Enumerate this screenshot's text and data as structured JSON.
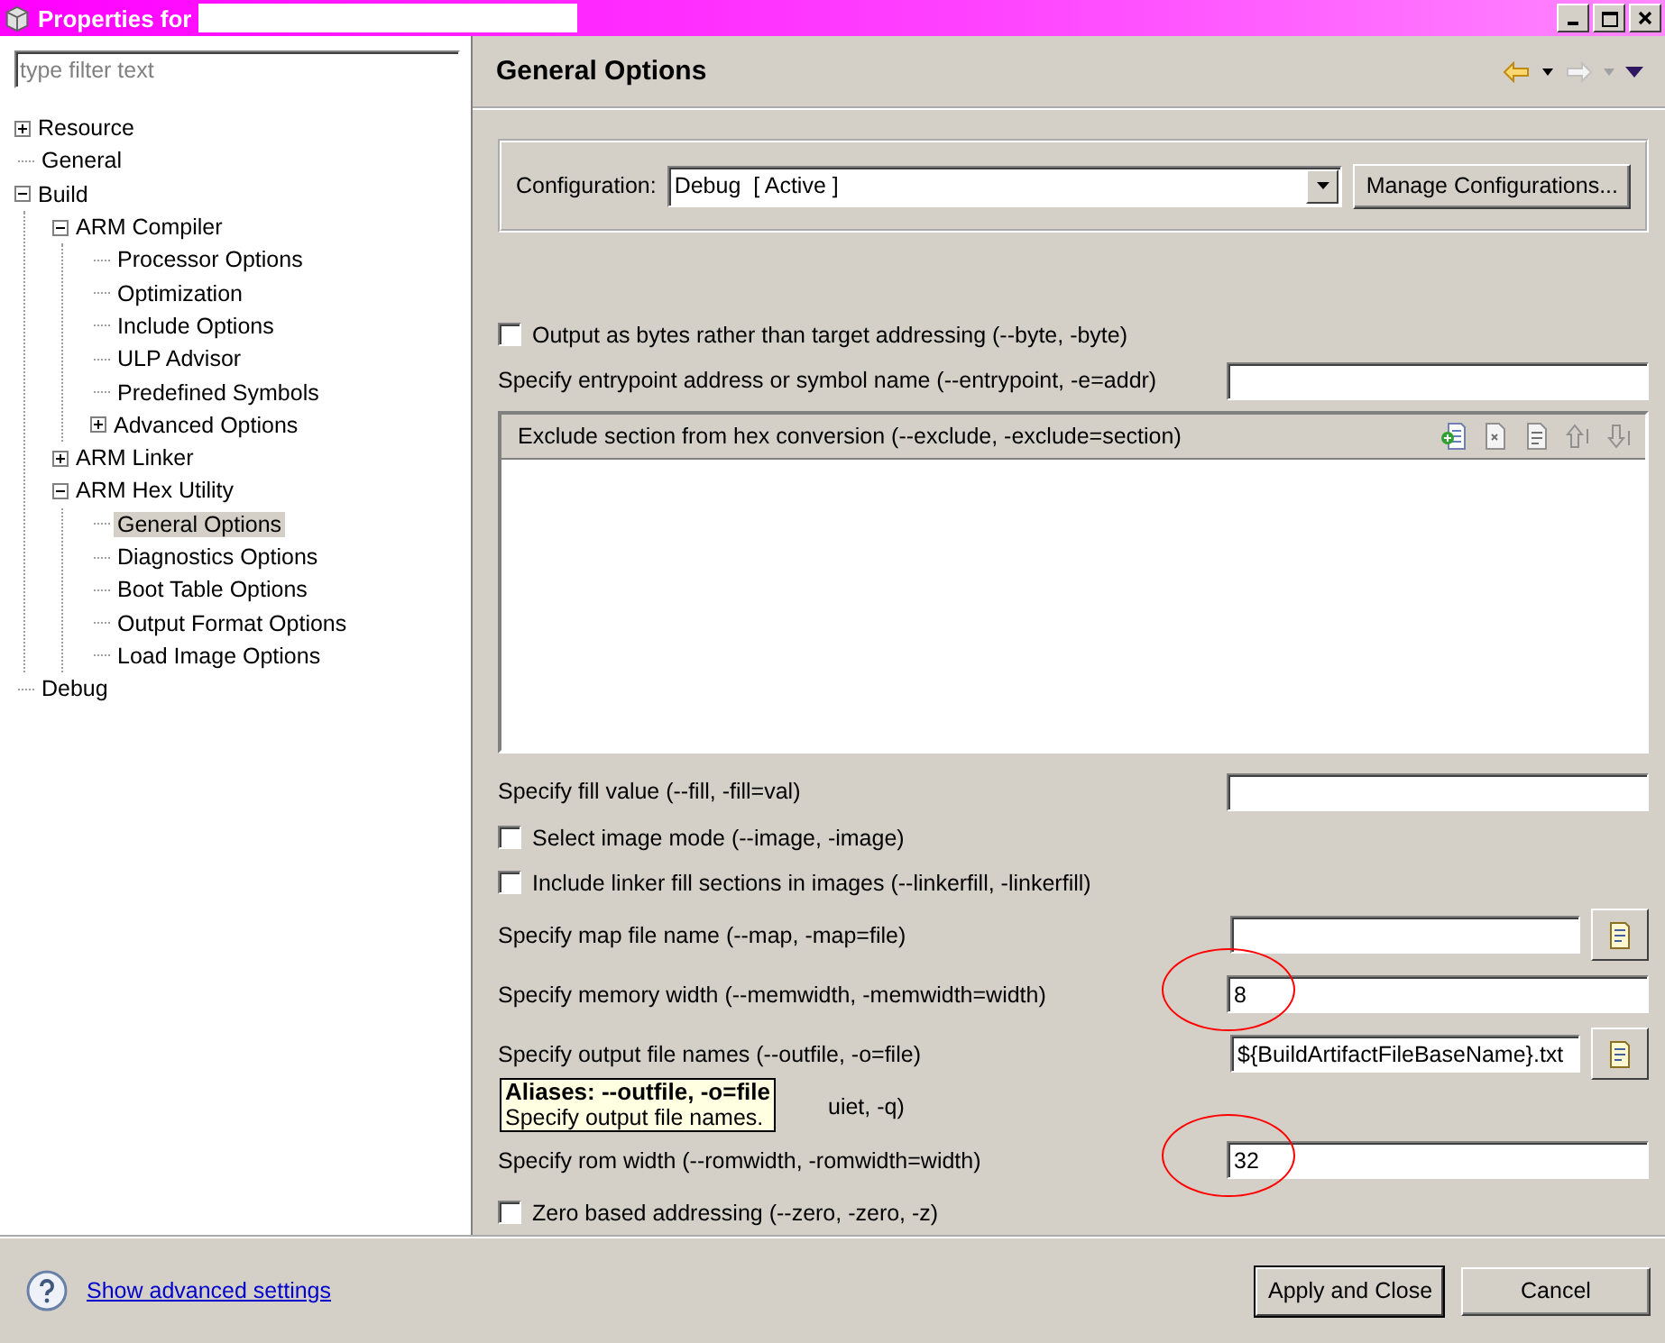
{
  "window": {
    "title": "Properties for"
  },
  "filter": {
    "placeholder": "type filter text"
  },
  "tree": [
    {
      "label": "Resource",
      "expanded": false,
      "selected": false
    },
    {
      "label": "General",
      "selected": false
    },
    {
      "label": "Build",
      "expanded": true,
      "selected": false,
      "children": [
        {
          "label": "ARM Compiler",
          "expanded": true,
          "selected": false,
          "children": [
            {
              "label": "Processor Options",
              "selected": false
            },
            {
              "label": "Optimization",
              "selected": false
            },
            {
              "label": "Include Options",
              "selected": false
            },
            {
              "label": "ULP Advisor",
              "selected": false
            },
            {
              "label": "Predefined Symbols",
              "selected": false
            },
            {
              "label": "Advanced Options",
              "expanded": false,
              "selected": false
            }
          ]
        },
        {
          "label": "ARM Linker",
          "expanded": false,
          "selected": false
        },
        {
          "label": "ARM Hex Utility",
          "expanded": true,
          "selected": false,
          "children": [
            {
              "label": "General Options",
              "selected": true
            },
            {
              "label": "Diagnostics Options",
              "selected": false
            },
            {
              "label": "Boot Table Options",
              "selected": false
            },
            {
              "label": "Output Format Options",
              "selected": false
            },
            {
              "label": "Load Image Options",
              "selected": false
            }
          ]
        }
      ]
    },
    {
      "label": "Debug",
      "selected": false
    }
  ],
  "page": {
    "title": "General Options"
  },
  "configuration": {
    "label": "Configuration:",
    "value": "Debug  [ Active ]",
    "button": "Manage Configurations..."
  },
  "options": [
    {
      "kind": "checkbox",
      "label": "Output as bytes rather than target addressing (--byte, -byte)",
      "checked": false
    },
    {
      "kind": "text",
      "label": "Specify entrypoint address or symbol name (--entrypoint, -e=addr)"
    },
    {
      "kind": "list",
      "label": "Exclude section from hex conversion (--exclude, -exclude=section)"
    },
    {
      "kind": "text",
      "label": "Specify fill value (--fill, -fill=val)"
    },
    {
      "kind": "checkbox",
      "label": "Select image mode (--image, -image)",
      "checked": false
    },
    {
      "kind": "checkbox",
      "label": "Include linker fill sections in images (--linkerfill, -linkerfill)",
      "checked": false
    },
    {
      "kind": "file",
      "label": "Specify map file name (--map, -map=file)"
    },
    {
      "kind": "text",
      "label": "Specify memory width (--memwidth, -memwidth=width)",
      "value": "8",
      "circled": true
    },
    {
      "kind": "file",
      "label": "Specify output file names (--outfile, -o=file)",
      "value": "${BuildArtifactFileBaseName}.txt",
      "tooltip": {
        "title": "Aliases: --outfile, -o=file",
        "text": "Specify output file names."
      }
    },
    {
      "kind": "partial",
      "label": "uiet, -q)"
    },
    {
      "kind": "text",
      "label": "Specify rom width (--romwidth, -romwidth=width)",
      "value": "32",
      "circled": true
    },
    {
      "kind": "checkbox",
      "label": "Zero based addressing (--zero, -zero, -z)",
      "checked": false
    }
  ],
  "footer": {
    "link": "Show advanced settings",
    "buttons": [
      {
        "label": "Apply and Close",
        "default": true
      },
      {
        "label": "Cancel",
        "default": false
      }
    ]
  }
}
